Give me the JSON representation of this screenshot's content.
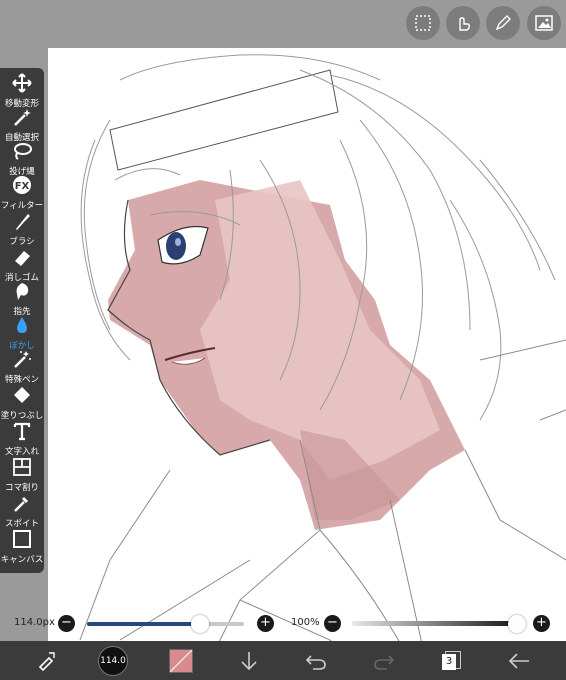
{
  "toolbar": {
    "items": [
      {
        "label": "移動変形",
        "icon": "move-icon",
        "active": false
      },
      {
        "label": "自動選択",
        "icon": "magic-wand-icon",
        "active": false
      },
      {
        "label": "投げ縄",
        "icon": "lasso-icon",
        "active": false
      },
      {
        "label": "フィルター",
        "icon": "fx-icon",
        "active": false
      },
      {
        "label": "ブラシ",
        "icon": "brush-icon",
        "active": false
      },
      {
        "label": "消しゴム",
        "icon": "eraser-icon",
        "active": false
      },
      {
        "label": "指先",
        "icon": "smudge-icon",
        "active": false
      },
      {
        "label": "ぼかし",
        "icon": "blur-drop-icon",
        "active": true
      },
      {
        "label": "特殊ペン",
        "icon": "special-pen-icon",
        "active": false
      },
      {
        "label": "塗りつぶし",
        "icon": "fill-bucket-icon",
        "active": false
      },
      {
        "label": "文字入れ",
        "icon": "text-icon",
        "active": false
      },
      {
        "label": "コマ割り",
        "icon": "panel-divide-icon",
        "active": false
      },
      {
        "label": "スポイト",
        "icon": "eyedropper-icon",
        "active": false
      },
      {
        "label": "キャンバス",
        "icon": "canvas-icon",
        "active": false
      }
    ],
    "active_color": "#3aa0ff"
  },
  "top_buttons": [
    {
      "icon": "selection-icon"
    },
    {
      "icon": "touch-gesture-icon"
    },
    {
      "icon": "pen-edit-icon"
    },
    {
      "icon": "image-icon"
    }
  ],
  "brush_size": {
    "label": "114.0px",
    "value": 114.0,
    "level": 0.72,
    "minus": "−",
    "plus": "+",
    "track_color": "#27497a"
  },
  "opacity": {
    "label": "100%",
    "value": 100,
    "minus": "−",
    "plus": "+"
  },
  "bottom_bar": {
    "brush_preview_label": "114.0",
    "layer_count": "3",
    "current_color": "#d98a8f"
  },
  "canvas": {
    "skin_color": "#d3a0a2",
    "skin_light": "#e8c4c4",
    "iris_color": "#2b3f73"
  }
}
